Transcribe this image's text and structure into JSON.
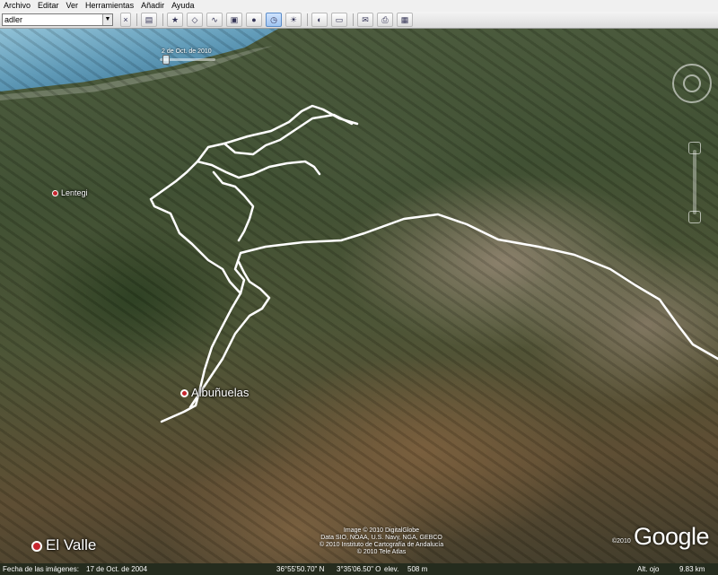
{
  "menu": {
    "items": [
      "Archivo",
      "Editar",
      "Ver",
      "Herramientas",
      "Añadir",
      "Ayuda"
    ]
  },
  "toolbar": {
    "search_value": "adler"
  },
  "time_slider": {
    "label": "2 de Oct. de 2010",
    "position": 0.05
  },
  "places": {
    "lentegi": "Lentegi",
    "albunuelas": "Albuñuelas",
    "el_valle": "El Valle"
  },
  "credits": {
    "line1": "Image © 2010 DigitalGlobe",
    "line2": "Data SIO, NOAA, U.S. Navy, NGA, GEBCO",
    "line3": "© 2010 Instituto de Cartografía de Andalucía",
    "line4": "© 2010 Tele Atlas"
  },
  "brand": {
    "copyright": "©2010",
    "logo": "Google"
  },
  "status": {
    "imagery_label": "Fecha de las imágenes:",
    "imagery_date": "17 de Oct. de 2004",
    "latitude": "36°55'50.70\" N",
    "longitude": "3°35'06.50\" O",
    "elevation_label": "elev.",
    "elevation": "508 m",
    "altitude_label": "Alt. ojo",
    "altitude": "9.83 km"
  },
  "icons": [
    "sidebar-icon",
    "placemark-icon",
    "polygon-icon",
    "path-icon",
    "overlay-icon",
    "record-tour-icon",
    "historical-imagery-icon",
    "sun-icon",
    "planets-icon",
    "ruler-icon",
    "email-icon",
    "print-icon",
    "maps-view-icon"
  ],
  "colors": {
    "route": "#ffffff",
    "pin": "#c6262e"
  }
}
